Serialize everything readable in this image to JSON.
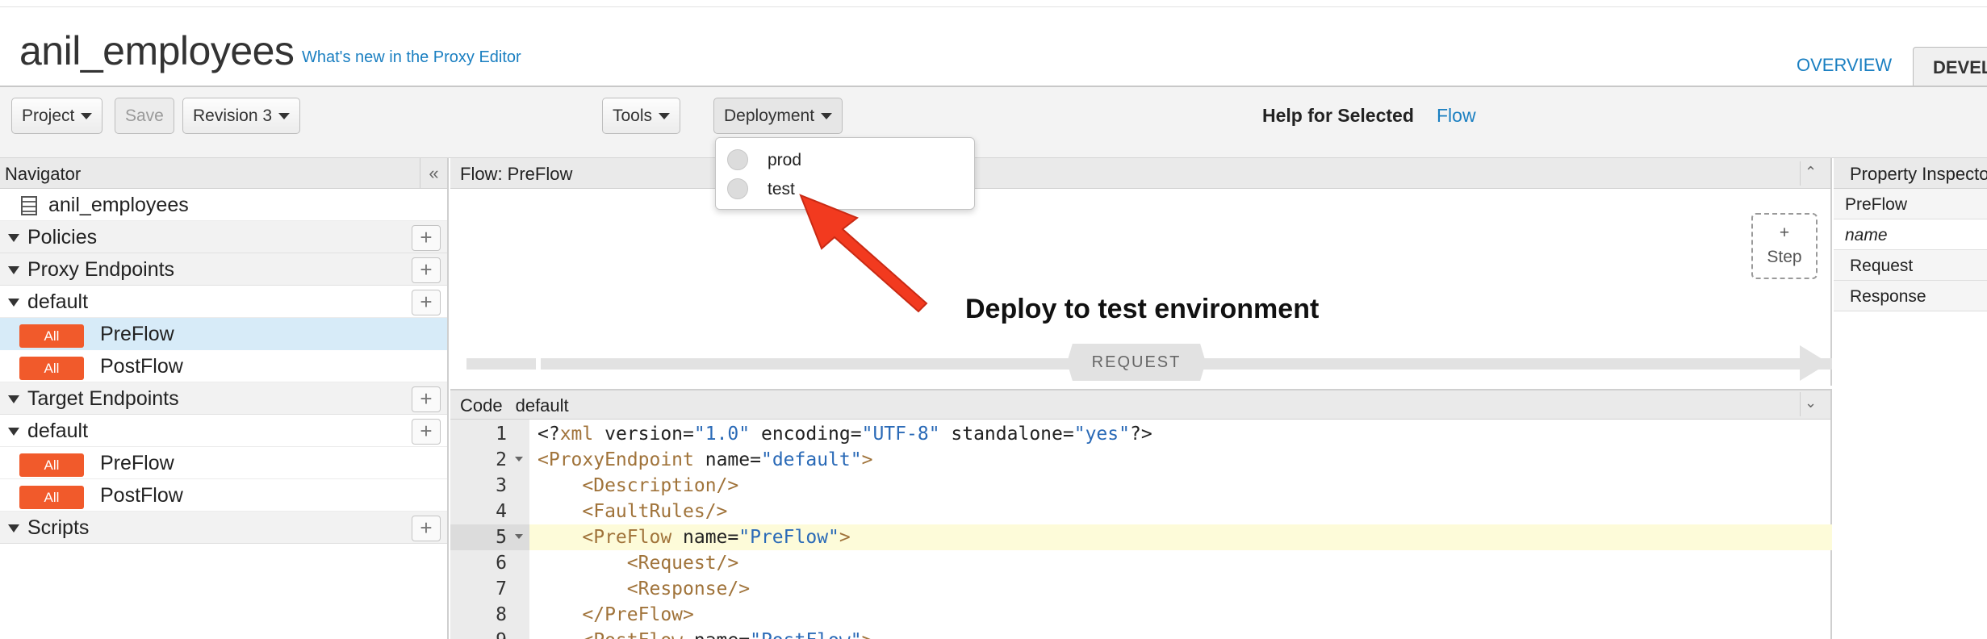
{
  "header": {
    "title": "anil_employees",
    "whats_new": "What's new in the Proxy Editor",
    "tab_overview": "OVERVIEW",
    "tab_develop": "DEVEL"
  },
  "toolbar": {
    "project": "Project",
    "save": "Save",
    "revision": "Revision 3",
    "tools": "Tools",
    "deployment": "Deployment",
    "help_label": "Help for Selected",
    "help_link": "Flow"
  },
  "deployment_menu": {
    "items": [
      "prod",
      "test"
    ]
  },
  "navigator": {
    "title": "Navigator",
    "collapse": "«",
    "root": "anil_employees",
    "policies": "Policies",
    "proxy_endpoints": "Proxy Endpoints",
    "proxy_default": "default",
    "proxy_flows": [
      {
        "badge": "All",
        "label": "PreFlow"
      },
      {
        "badge": "All",
        "label": "PostFlow"
      }
    ],
    "target_endpoints": "Target Endpoints",
    "target_default": "default",
    "target_flows": [
      {
        "badge": "All",
        "label": "PreFlow"
      },
      {
        "badge": "All",
        "label": "PostFlow"
      }
    ],
    "scripts": "Scripts",
    "plus": "+"
  },
  "flow_panel": {
    "title": "Flow: PreFlow",
    "step_plus": "+",
    "step_label": "Step",
    "request_label": "REQUEST"
  },
  "annotation": "Deploy to test environment",
  "code_panel": {
    "label": "Code",
    "name": "default",
    "line_numbers": [
      "1",
      "2",
      "3",
      "4",
      "5",
      "6",
      "7",
      "8",
      "9"
    ]
  },
  "property_inspector": {
    "title": "Property Inspector",
    "rows": [
      "PreFlow",
      "name",
      "Request",
      "Response"
    ]
  },
  "colors": {
    "badge": "#f15a2b",
    "link": "#1a7fc1",
    "annotation_arrow": "#f23a1f",
    "highlight_line": "#fdfbd9"
  }
}
